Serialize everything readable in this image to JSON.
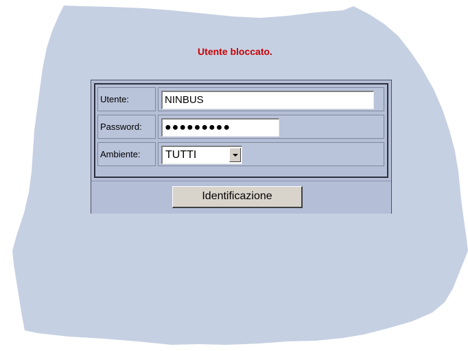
{
  "header": {
    "cut_off_text": "...",
    "error_message": "Utente bloccato."
  },
  "login_form": {
    "username_label": "Utente:",
    "username_value": "NINBUS",
    "password_label": "Password:",
    "password_value": "●●●●●●●●●",
    "environment_label": "Ambiente:",
    "environment_selected": "TUTTI",
    "submit_label": "Identificazione"
  },
  "colors": {
    "background_blob": "#c6d0e3",
    "panel": "#b4bed6",
    "error_text": "#c80000",
    "cut_text": "#1a1ac8"
  },
  "icons": {
    "dropdown_arrow": "chevron-down-icon"
  }
}
